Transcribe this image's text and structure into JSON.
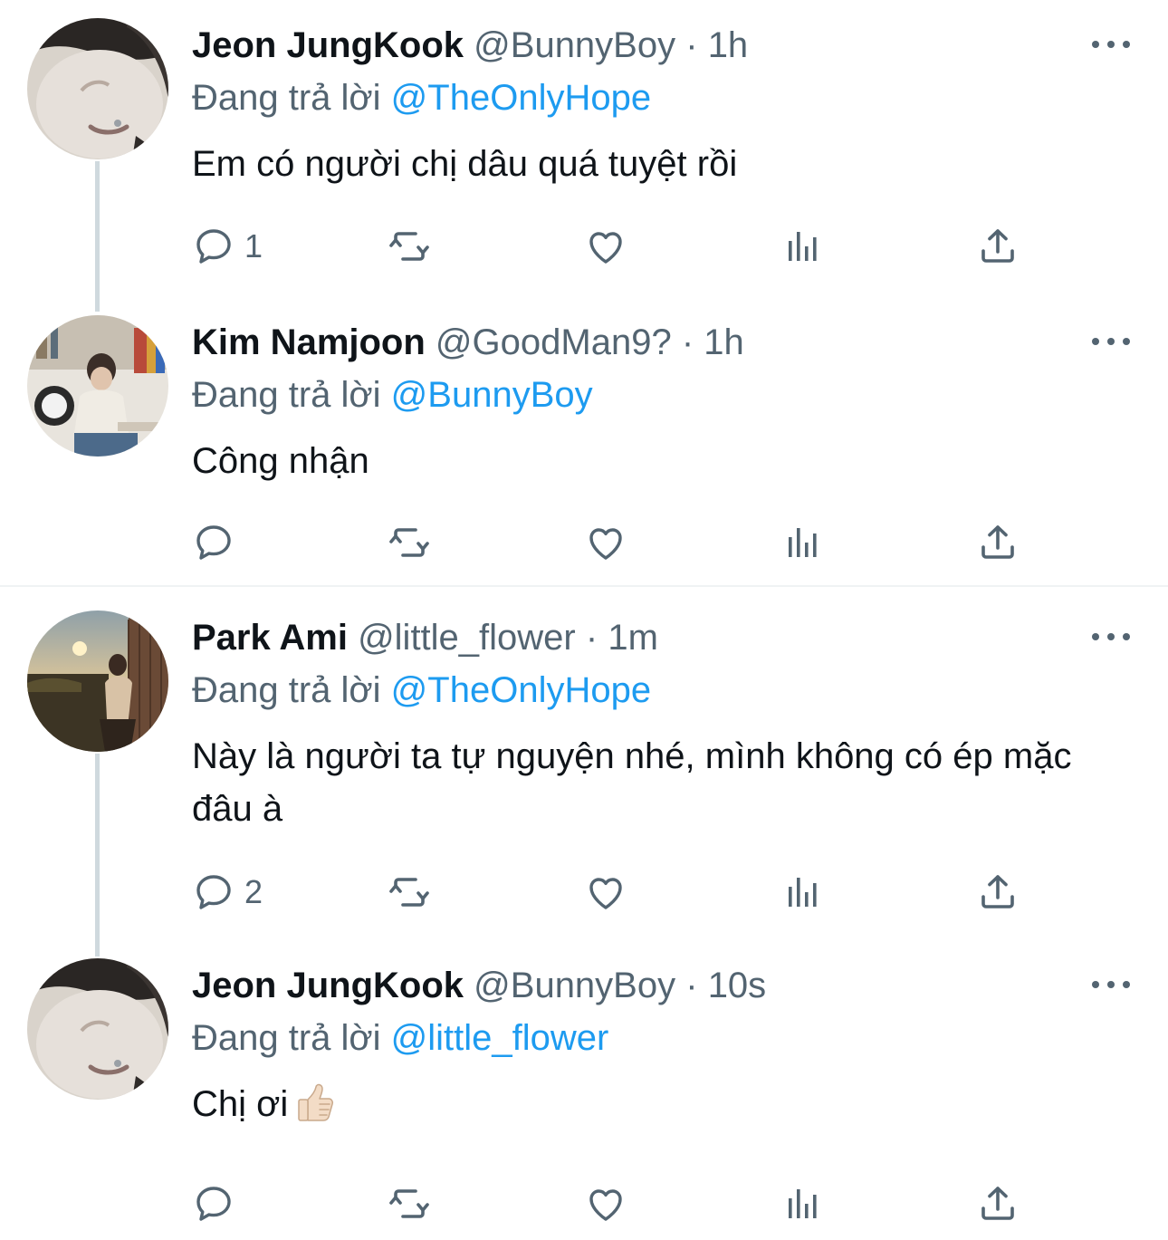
{
  "tweets": [
    {
      "name": "Jeon JungKook",
      "handle": "@BunnyBoy",
      "dot": "·",
      "time": "1h",
      "replying_prefix": "Đang trả lời",
      "replying_to": "@TheOnlyHope",
      "text": "Em có người chị dâu quá tuyệt rồi",
      "reply_count": "1",
      "avatar_icon": "avatar-face"
    },
    {
      "name": "Kim Namjoon",
      "handle": "@GoodMan9?",
      "dot": "·",
      "time": "1h",
      "replying_prefix": "Đang trả lời",
      "replying_to": "@BunnyBoy",
      "text": "Công nhận",
      "reply_count": "",
      "avatar_icon": "avatar-studio"
    },
    {
      "name": "Park Ami",
      "handle": "@little_flower",
      "dot": "·",
      "time": "1m",
      "replying_prefix": "Đang trả lời",
      "replying_to": "@TheOnlyHope",
      "text": "Này là người ta tự nguyện nhé, mình không có ép mặc đâu à",
      "reply_count": "2",
      "avatar_icon": "avatar-sunset"
    },
    {
      "name": "Jeon JungKook",
      "handle": "@BunnyBoy",
      "dot": "·",
      "time": "10s",
      "replying_prefix": "Đang trả lời",
      "replying_to": "@little_flower",
      "text": "Chị ơi",
      "reply_count": "",
      "avatar_icon": "avatar-face",
      "emoji": "thumbs-up"
    }
  ],
  "colors": {
    "text": "#0f1419",
    "secondary": "#536471",
    "link": "#1d9bf0",
    "thread_line": "#cfd9de",
    "divider": "#eff3f4"
  }
}
